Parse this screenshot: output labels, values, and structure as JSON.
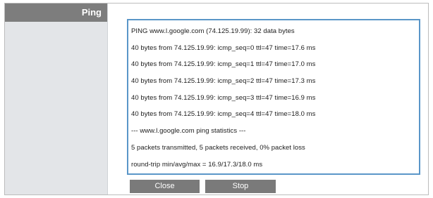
{
  "sidebar": {
    "title": "Ping"
  },
  "output": {
    "lines": [
      "PING www.l.google.com (74.125.19.99): 32 data bytes",
      "40 bytes from 74.125.19.99: icmp_seq=0 ttl=47 time=17.6 ms",
      "40 bytes from 74.125.19.99: icmp_seq=1 ttl=47 time=17.0 ms",
      "40 bytes from 74.125.19.99: icmp_seq=2 ttl=47 time=17.3 ms",
      "40 bytes from 74.125.19.99: icmp_seq=3 ttl=47 time=16.9 ms",
      "40 bytes from 74.125.19.99: icmp_seq=4 ttl=47 time=18.0 ms",
      "--- www.l.google.com ping statistics ---",
      "5 packets transmitted, 5 packets received, 0% packet loss",
      "round-trip min/avg/max = 16.9/17.3/18.0 ms"
    ]
  },
  "buttons": {
    "close_label": "Close",
    "stop_label": "Stop"
  },
  "colors": {
    "header_bg": "#7d7d7d",
    "output_border": "#5a96c8",
    "button_bg": "#7a7a7a"
  }
}
